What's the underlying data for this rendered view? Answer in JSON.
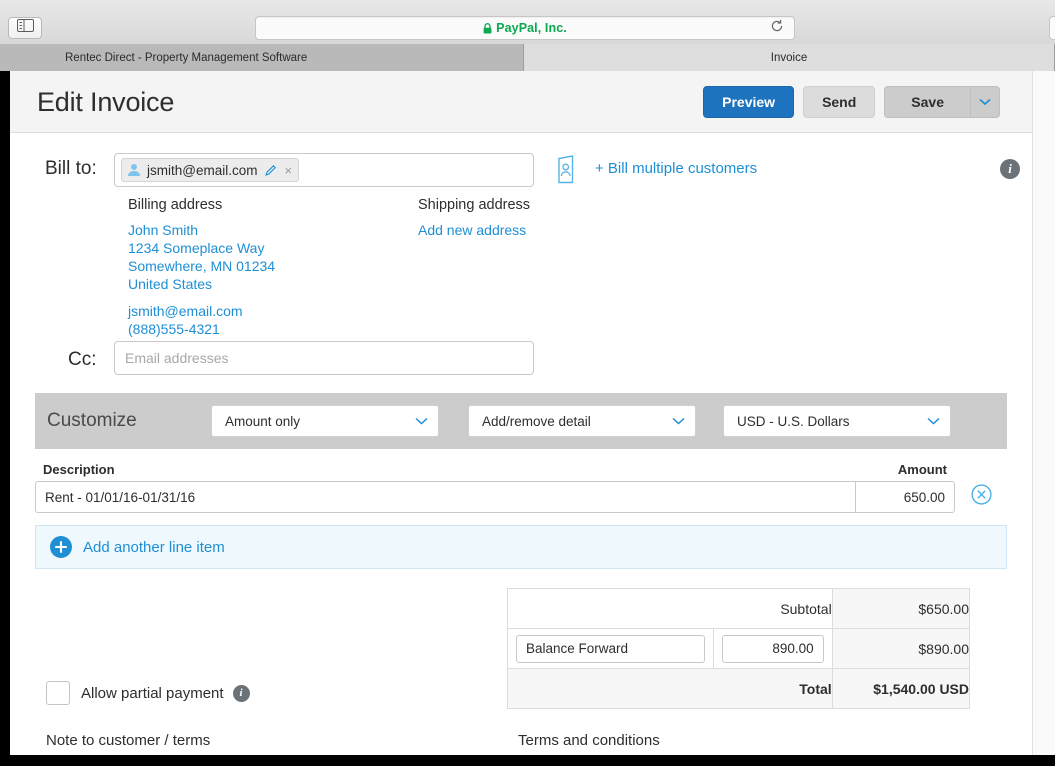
{
  "browser": {
    "sidebar_toggle_icon": "sidebar-icon",
    "url_text": "PayPal, Inc.",
    "lock_icon": "lock-icon",
    "reload_icon": "reload-icon",
    "tabs": [
      {
        "label": "Rentec Direct - Property Management Software",
        "active": false
      },
      {
        "label": "Invoice",
        "active": true
      }
    ]
  },
  "header": {
    "title": "Edit Invoice",
    "preview_label": "Preview",
    "send_label": "Send",
    "save_label": "Save",
    "save_dropdown_icon": "chevron-down-icon"
  },
  "bill_to": {
    "label": "Bill to:",
    "token": {
      "avatar_icon": "person-icon",
      "email": "jsmith@email.com",
      "edit_icon": "pencil-icon",
      "remove_icon": "close-icon"
    },
    "multi_customer_icon": "address-card-icon",
    "multi_customer_link": "+ Bill multiple customers",
    "info_icon": "info-icon"
  },
  "addresses": {
    "billing": {
      "heading": "Billing address",
      "lines": [
        "John Smith",
        "1234 Someplace Way",
        "Somewhere, MN 01234",
        "United States"
      ],
      "contact": [
        "jsmith@email.com",
        "(888)555-4321"
      ]
    },
    "shipping": {
      "heading": "Shipping address",
      "add_link": "Add new address"
    }
  },
  "cc": {
    "label": "Cc:",
    "value": "",
    "placeholder": "Email addresses"
  },
  "customize": {
    "label": "Customize",
    "selects": [
      {
        "name": "invoice-style",
        "value": "Amount only",
        "chevron_icon": "chevron-down-icon"
      },
      {
        "name": "add-remove-detail",
        "value": "Add/remove detail",
        "chevron_icon": "chevron-down-icon"
      },
      {
        "name": "currency",
        "value": "USD - U.S. Dollars",
        "chevron_icon": "chevron-down-icon"
      }
    ]
  },
  "line_items": {
    "columns": {
      "description": "Description",
      "amount": "Amount"
    },
    "rows": [
      {
        "description": "Rent - 01/01/16-01/31/16",
        "amount": "650.00",
        "delete_icon": "circle-x-icon"
      }
    ],
    "add_label": "Add another line item",
    "add_icon": "plus-circle-icon"
  },
  "totals": {
    "subtotal_label": "Subtotal",
    "subtotal_value": "$650.00",
    "adjustment_desc": "Balance Forward",
    "adjustment_amount": "890.00",
    "adjustment_value": "$890.00",
    "total_label": "Total",
    "total_value": "$1,540.00 USD"
  },
  "partial_payment": {
    "label": "Allow partial payment",
    "checked": false,
    "info_icon": "info-icon"
  },
  "bottom_cutoff": {
    "left_text": "Note to customer / terms",
    "right_text": "Terms and conditions"
  },
  "colors": {
    "accent_blue": "#1e8fd5",
    "primary_button": "#1e73be",
    "customize_band": "#cccccc",
    "add_item_bg": "#eef8fd",
    "url_green": "#0aa84f"
  }
}
